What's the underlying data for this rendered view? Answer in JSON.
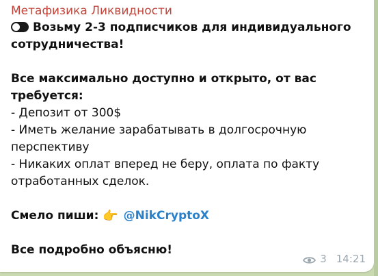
{
  "message": {
    "sender": "Метафизика Ликвидности",
    "line1": "Возьму 2-3 подписчиков для индивидуального",
    "line2": "сотрудничества!",
    "line3": "Все максимально доступно и открыто, от вас",
    "line4": "требуется:",
    "item1": "- Депозит от 300$",
    "item2a": "- Иметь желание зарабатывать в долгосрочную",
    "item2b": "перспективу",
    "item3a": "- Никаких оплат вперед не беру, оплата по факту",
    "item3b": "отработанных сделок.",
    "write_label": "Смело пиши:",
    "point_glyph": "👉",
    "mention": "@NikCryptoX",
    "closing": "Все подробно объясню!"
  },
  "meta": {
    "views": "3",
    "time": "14:21"
  },
  "icons": {
    "toggle": "toggle-icon",
    "pointing": "pointing-hand-icon",
    "views": "eye-icon"
  },
  "colors": {
    "sender": "#c0453a",
    "mention": "#2a80c9",
    "meta": "#9aa6ae",
    "background": "#c9d9b0"
  }
}
